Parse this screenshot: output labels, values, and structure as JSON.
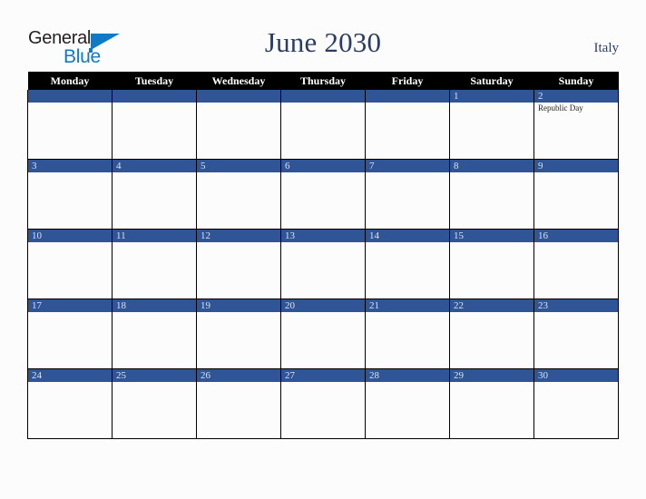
{
  "brand": {
    "logo_line1": "General",
    "logo_line2": "Blue",
    "logo_triangle_icon": "triangle-icon",
    "accent_blue": "#1279c4"
  },
  "header": {
    "title": "June 2030",
    "country": "Italy",
    "title_color": "#2b3d62"
  },
  "calendar": {
    "month": "June",
    "year": "2030",
    "header_background": "#000000",
    "daynum_background": "#2f5597",
    "weekday_headers": [
      "Monday",
      "Tuesday",
      "Wednesday",
      "Thursday",
      "Friday",
      "Saturday",
      "Sunday"
    ],
    "weeks": [
      [
        {
          "day": "",
          "events": []
        },
        {
          "day": "",
          "events": []
        },
        {
          "day": "",
          "events": []
        },
        {
          "day": "",
          "events": []
        },
        {
          "day": "",
          "events": []
        },
        {
          "day": "1",
          "events": []
        },
        {
          "day": "2",
          "events": [
            "Republic Day"
          ]
        }
      ],
      [
        {
          "day": "3",
          "events": []
        },
        {
          "day": "4",
          "events": []
        },
        {
          "day": "5",
          "events": []
        },
        {
          "day": "6",
          "events": []
        },
        {
          "day": "7",
          "events": []
        },
        {
          "day": "8",
          "events": []
        },
        {
          "day": "9",
          "events": []
        }
      ],
      [
        {
          "day": "10",
          "events": []
        },
        {
          "day": "11",
          "events": []
        },
        {
          "day": "12",
          "events": []
        },
        {
          "day": "13",
          "events": []
        },
        {
          "day": "14",
          "events": []
        },
        {
          "day": "15",
          "events": []
        },
        {
          "day": "16",
          "events": []
        }
      ],
      [
        {
          "day": "17",
          "events": []
        },
        {
          "day": "18",
          "events": []
        },
        {
          "day": "19",
          "events": []
        },
        {
          "day": "20",
          "events": []
        },
        {
          "day": "21",
          "events": []
        },
        {
          "day": "22",
          "events": []
        },
        {
          "day": "23",
          "events": []
        }
      ],
      [
        {
          "day": "24",
          "events": []
        },
        {
          "day": "25",
          "events": []
        },
        {
          "day": "26",
          "events": []
        },
        {
          "day": "27",
          "events": []
        },
        {
          "day": "28",
          "events": []
        },
        {
          "day": "29",
          "events": []
        },
        {
          "day": "30",
          "events": []
        }
      ]
    ]
  }
}
